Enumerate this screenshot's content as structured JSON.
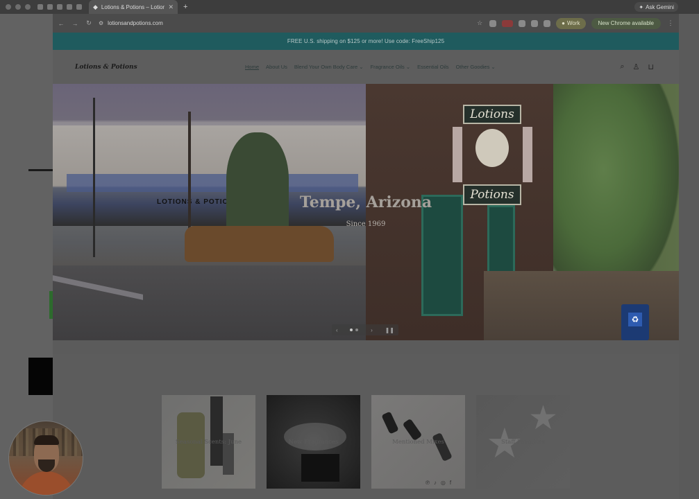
{
  "browser": {
    "tab_title": "Lotions & Potions – Lotions &",
    "new_tab_glyph": "+",
    "ask_gemini": "Ask Gemini",
    "url": "lotionsandpotions.com",
    "work_label": "Work",
    "update_label": "New Chrome available"
  },
  "site": {
    "promo_banner": "FREE U.S. shipping on $125 or more! Use code: FreeShip125",
    "logo_text": "Lotions & Potions",
    "nav": [
      {
        "label": "Home"
      },
      {
        "label": "About Us"
      },
      {
        "label": "Blend Your Own Body Care ⌄"
      },
      {
        "label": "Fragrance Oils ⌄"
      },
      {
        "label": "Essential Oils"
      },
      {
        "label": "Other Goodies ⌄"
      }
    ],
    "hero": {
      "title": "Tempe, Arizona",
      "subtitle": "Since 1969",
      "store_sign_left": "LOTIONS & POTIONS",
      "sign_top": "Lotions",
      "sign_bottom": "Potions"
    },
    "collections": [
      {
        "label": "Seasonal Scents: June"
      },
      {
        "label": "New Fragrances"
      },
      {
        "label": "Mentioned Mixes"
      },
      {
        "label": "Staff Favorites"
      }
    ]
  }
}
